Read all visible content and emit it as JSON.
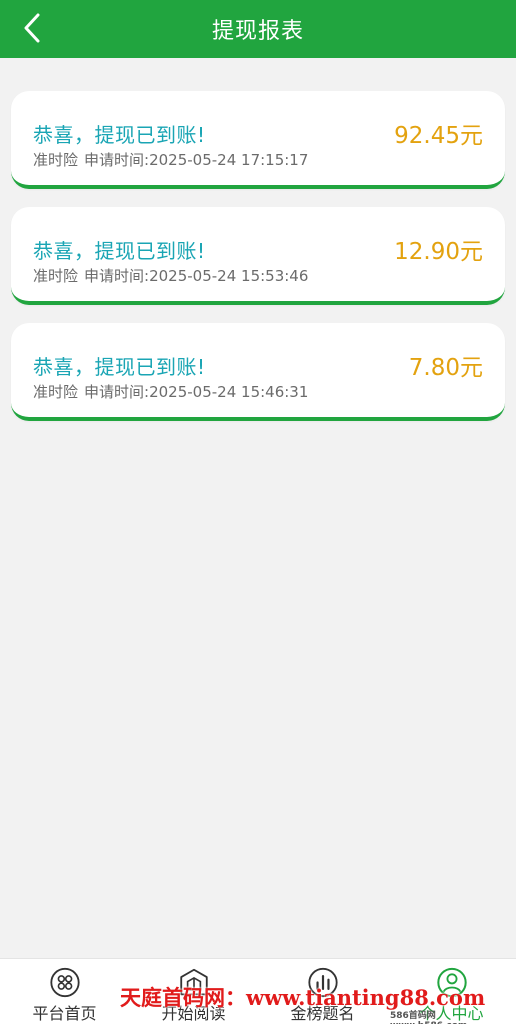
{
  "header": {
    "title": "提现报表",
    "back_icon": "chevron-left-icon"
  },
  "records": [
    {
      "title": "恭喜，提现已到账!",
      "type": "准时险",
      "time_label": "申请时间:",
      "time": "2025-05-24 17:15:17",
      "amount": "92.45元"
    },
    {
      "title": "恭喜，提现已到账!",
      "type": "准时险",
      "time_label": "申请时间:",
      "time": "2025-05-24 15:53:46",
      "amount": "12.90元"
    },
    {
      "title": "恭喜，提现已到账!",
      "type": "准时险",
      "time_label": "申请时间:",
      "time": "2025-05-24 15:46:31",
      "amount": "7.80元"
    }
  ],
  "tabbar": {
    "items": [
      {
        "label": "平台首页",
        "icon": "grid-circles-icon"
      },
      {
        "label": "开始阅读",
        "icon": "book-house-icon"
      },
      {
        "label": "金榜题名",
        "icon": "bar-chart-icon"
      },
      {
        "label": "个人中心",
        "icon": "user-icon",
        "active": true
      }
    ]
  },
  "watermark": {
    "text": "天庭首码网：www.tianting88.com",
    "small_text": "586首码网 www.h586.com"
  },
  "colors": {
    "brand_green": "#21a53f",
    "title_teal": "#1aa5b4",
    "amount_orange": "#e3a20f",
    "watermark_red": "#e11b1b"
  }
}
